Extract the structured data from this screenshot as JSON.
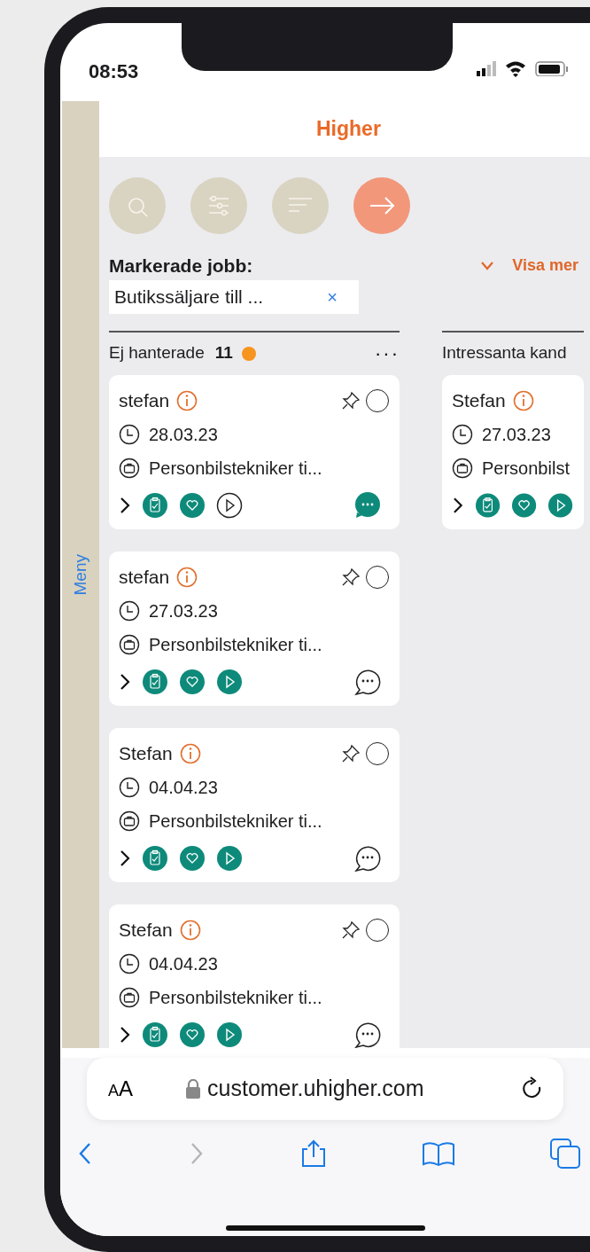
{
  "status_bar": {
    "time": "08:53"
  },
  "sidebar": {
    "label": "Meny"
  },
  "header": {
    "logo": "Higher"
  },
  "toolbar": [
    {
      "kind": "search",
      "active": false
    },
    {
      "kind": "filter",
      "active": false
    },
    {
      "kind": "sort",
      "active": false
    },
    {
      "kind": "next",
      "active": true
    }
  ],
  "marked_jobs": {
    "label": "Markerade jobb:",
    "show_more": "Visa mer",
    "chips": [
      {
        "label": "Butikssäljare till ...",
        "remove": "×"
      }
    ]
  },
  "columns": [
    {
      "title": "Ej hanterade",
      "count": "11",
      "color": "#f7941d",
      "menu": "···",
      "cards": [
        {
          "name": "stefan",
          "date": "28.03.23",
          "job": "Personbilstekniker ti...",
          "selected": false,
          "play_active": false,
          "chat_active": true
        },
        {
          "name": "stefan",
          "date": "27.03.23",
          "job": "Personbilstekniker ti...",
          "selected": false,
          "play_active": true,
          "chat_active": false
        },
        {
          "name": "Stefan",
          "date": "04.04.23",
          "job": "Personbilstekniker ti...",
          "selected": false,
          "play_active": true,
          "chat_active": false
        },
        {
          "name": "Stefan",
          "date": "04.04.23",
          "job": "Personbilstekniker ti...",
          "selected": false,
          "play_active": true,
          "chat_active": false
        }
      ]
    },
    {
      "title": "Intressanta kand",
      "cards": [
        {
          "name": "Stefan",
          "date": "27.03.23",
          "job": "Personbilst",
          "play_active": true
        }
      ]
    }
  ],
  "browser": {
    "text_size": "AA",
    "url": "customer.uhigher.com",
    "nav": [
      {
        "kind": "back",
        "disabled": false
      },
      {
        "kind": "forward",
        "disabled": true
      },
      {
        "kind": "share",
        "disabled": false
      },
      {
        "kind": "bookmarks",
        "disabled": false
      },
      {
        "kind": "tabs",
        "disabled": false
      }
    ]
  }
}
